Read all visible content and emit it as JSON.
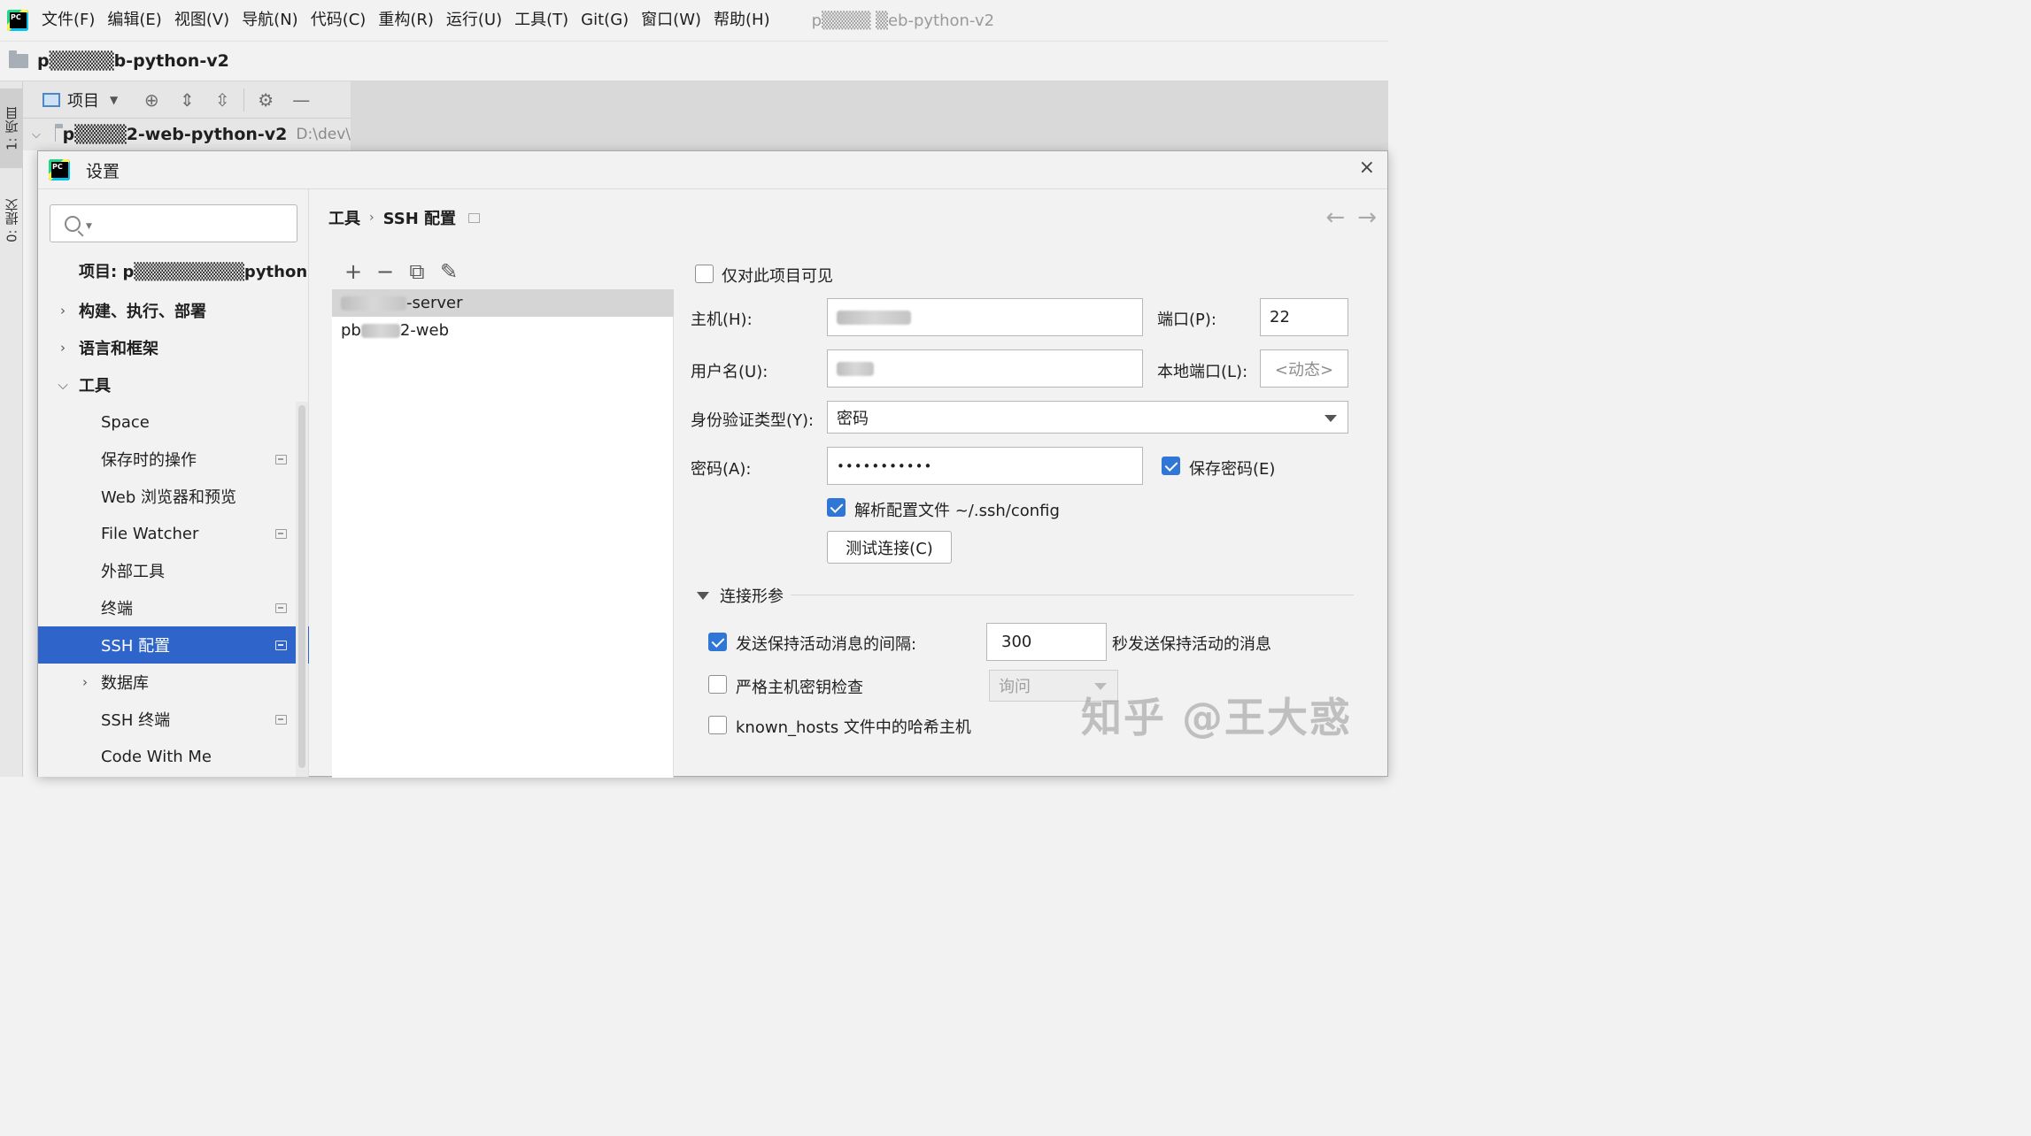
{
  "menubar": {
    "items": [
      "文件(F)",
      "编辑(E)",
      "视图(V)",
      "导航(N)",
      "代码(C)",
      "重构(R)",
      "运行(U)",
      "工具(T)",
      "Git(G)",
      "窗口(W)",
      "帮助(H)"
    ],
    "window_title": "p▒▒▒▒ ▒eb-python-v2"
  },
  "navbar": {
    "project_name": "p▒▒▒▒▒b-python-v2"
  },
  "tool_windows": {
    "project_tab": "1: 项目",
    "commit_tab": "0: 提交"
  },
  "project_panel": {
    "view_label": "项目",
    "root_name": "p▒▒▒▒2-web-python-v2",
    "root_path": "D:\\dev\\"
  },
  "dialog": {
    "title": "设置",
    "close_glyph": "×",
    "search": {
      "value": "",
      "placeholder": ""
    },
    "tree": {
      "project": "项目: p▒▒▒▒▒▒▒▒▒python...",
      "build": "构建、执行、部署",
      "languages": "语言和框架",
      "tools": "工具",
      "space": "Space",
      "on_save": "保存时的操作",
      "web_browsers": "Web 浏览器和预览",
      "file_watcher": "File Watcher",
      "external_tools": "外部工具",
      "terminal": "终端",
      "ssh_config": "SSH 配置",
      "database": "数据库",
      "ssh_terminal": "SSH 终端",
      "code_with_me": "Code With Me"
    },
    "breadcrumb": {
      "parent": "工具",
      "current": "SSH 配置"
    },
    "hosts": {
      "items": [
        {
          "suffix": "-server"
        },
        {
          "prefix": "pb",
          "suffix": "2-web"
        }
      ]
    },
    "form": {
      "visible_only_project": "仅对此项目可见",
      "host_label": "主机(H):",
      "port_label": "端口(P):",
      "port_value": "22",
      "username_label": "用户名(U):",
      "local_port_label": "本地端口(L):",
      "local_port_placeholder": "<动态>",
      "auth_type_label": "身份验证类型(Y):",
      "auth_type_value": "密码",
      "password_label": "密码(A):",
      "password_mask": "•••••••••••",
      "save_password": "保存密码(E)",
      "parse_config": "解析配置文件 ~/.ssh/config",
      "test_connection": "测试连接(C)",
      "section_title": "连接形参",
      "keepalive_label": "发送保持活动消息的间隔:",
      "keepalive_value": "300",
      "keepalive_unit": "秒发送保持活动的消息",
      "strict_host_key": "严格主机密钥检查",
      "strict_value": "询问",
      "hash_known_hosts": "known_hosts 文件中的哈希主机"
    },
    "state": {
      "visible_only_project": false,
      "save_password": true,
      "parse_config": true,
      "keepalive": true,
      "strict_host_key": false,
      "hash_known_hosts": false
    }
  },
  "watermark": "知乎 @王大惑",
  "colors": {
    "selection": "#2f65ca",
    "checkbox": "#2f76d6"
  }
}
